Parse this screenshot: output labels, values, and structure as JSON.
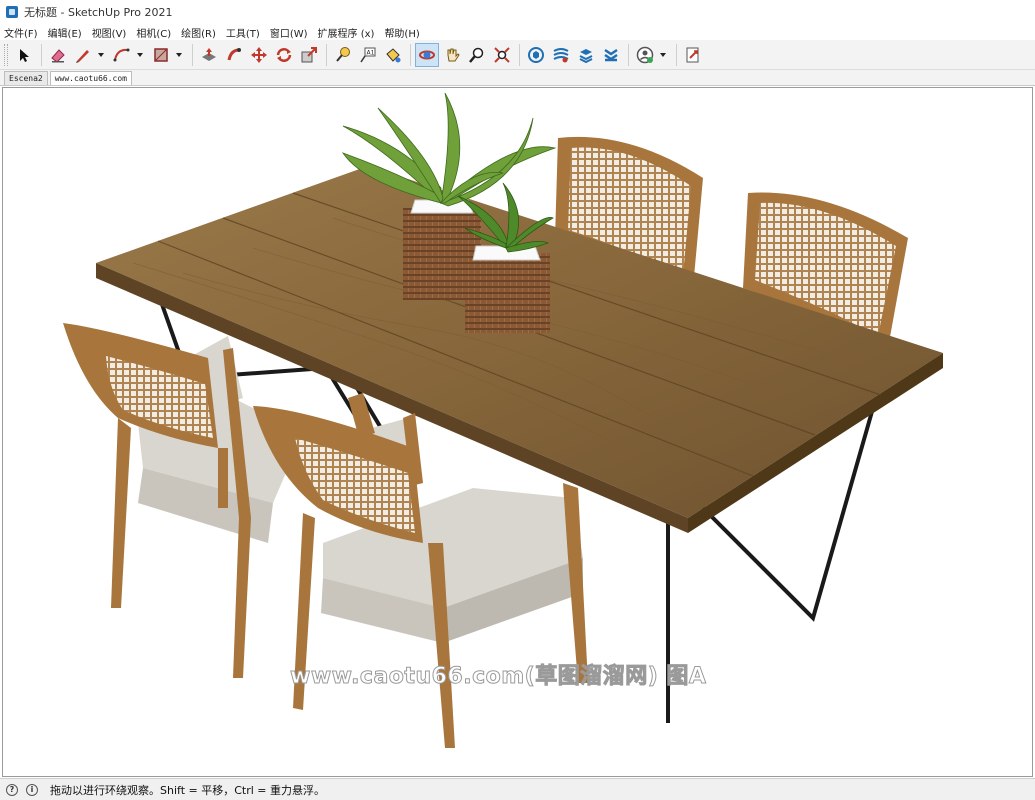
{
  "window": {
    "title": "无标题 - SketchUp Pro 2021"
  },
  "menu": [
    {
      "label": "文件(F)"
    },
    {
      "label": "编辑(E)"
    },
    {
      "label": "视图(V)"
    },
    {
      "label": "相机(C)"
    },
    {
      "label": "绘图(R)"
    },
    {
      "label": "工具(T)"
    },
    {
      "label": "窗口(W)"
    },
    {
      "label": "扩展程序 (x)"
    },
    {
      "label": "帮助(H)"
    }
  ],
  "toolbar": {
    "tools": [
      "select-icon",
      "eraser-icon",
      "pencil-line-icon",
      "arc-icon",
      "rectangle-icon",
      "push-pull-icon",
      "follow-me-icon",
      "move-icon",
      "rotate-icon",
      "scale-icon",
      "tape-measure-icon",
      "text-icon",
      "paint-bucket-icon",
      "orbit-icon",
      "pan-icon",
      "zoom-icon",
      "zoom-extents-icon",
      "3d-warehouse-icon",
      "extension-warehouse-icon",
      "layout-icon",
      "extension-manager-icon",
      "user-account-icon",
      "send-to-layout-icon"
    ],
    "active_tool": "orbit-icon"
  },
  "tabs": [
    {
      "label": "Escena2"
    },
    {
      "label": "www.caotu66.com"
    }
  ],
  "viewport": {
    "model": "dining-table-with-four-chairs-and-potted-plants",
    "watermark": "www.caotu66.com(草图溜溜网) 图A"
  },
  "status": {
    "icons": [
      "help-circle-icon",
      "info-circle-icon"
    ],
    "message": "拖动以进行环绕观察。Shift = 平移，Ctrl = 重力悬浮。"
  },
  "colors": {
    "wood": "#8a6a3e",
    "wood_dark": "#5e4424",
    "chair_frame": "#a8763c",
    "cushion": "#d9d6cf",
    "leaf": "#6fa03a",
    "metal": "#1a1a1a",
    "active_tool_bg": "#cde4f7"
  }
}
